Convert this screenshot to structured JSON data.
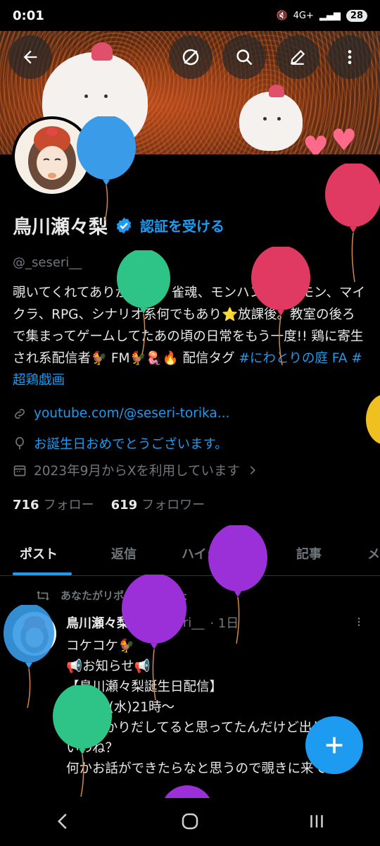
{
  "status_bar": {
    "time": "0:01",
    "battery": "28",
    "network": "4G+"
  },
  "profile": {
    "name": "鳥川瀬々梨",
    "verify_label": "認証を受ける",
    "handle": "@_seseri__",
    "bio_text": "覗いてくれてありがとう！ 雀魂、モンハン、ポケモン、マイクラ、RPG、シナリオ系何でもあり⭐放課後。教室の後ろで集まってゲームしてたあの頃の日常をもう一度!! 鶏に寄生され系配信者🐓 FM🐓🪼🔥 配信タグ ",
    "bio_tags": "#にわとりの庭 FA #超鶏戯画",
    "website": "youtube.com/@seseri-torika...",
    "birthday": "お誕生日おめでとうございます。",
    "joined": "2023年9月からXを利用しています",
    "following_count": "716",
    "following_label": "フォロー",
    "followers_count": "619",
    "followers_label": "フォロワー"
  },
  "tabs": [
    "ポスト",
    "返信",
    "ハイライト",
    "記事",
    "メ"
  ],
  "post": {
    "repost_label": "あなたがリポストしました",
    "author_name": "鳥川瀬々梨",
    "author_handle": "@_seseri__",
    "time": "· 1日",
    "body": "コケコケ🐓\n📢お知らせ📢\n【鳥川瀬々梨誕生日配信】\n4月8日(水)21時〜\n私すっかりだしてると思ってたんだけど出してないわね？\n何かお話ができたらなと思うので覗きに来てね！"
  },
  "colors": {
    "accent": "#1d9bf0",
    "background": "#000000",
    "text": "#e7e9ea",
    "muted": "#71767b"
  },
  "icons": [
    "back-arrow-icon",
    "circle-slash-icon",
    "search-icon",
    "edit-pencil-icon",
    "more-vertical-icon",
    "verified-badge-icon",
    "link-icon",
    "balloon-icon",
    "calendar-icon",
    "chevron-right-icon",
    "repost-icon",
    "plus-icon"
  ]
}
